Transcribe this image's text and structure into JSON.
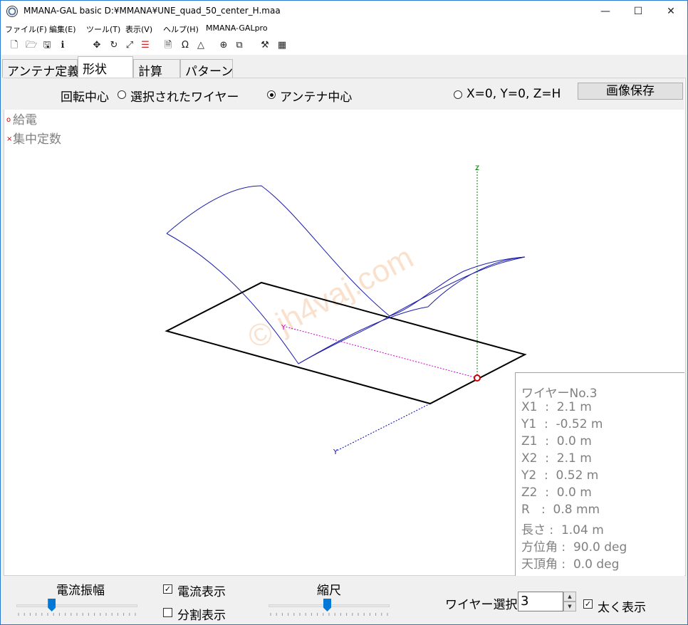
{
  "window": {
    "title": "MMANA-GAL basic  D:¥MMANA¥UNE_quad_50_center_H.maa",
    "min_glyph": "—",
    "max_glyph": "☐",
    "close_glyph": "✕"
  },
  "menu": [
    "ファイル(F)",
    "編集(E)",
    "ツール(T)",
    "表示(V)",
    "ヘルプ(H)",
    "MMANA-GALpro"
  ],
  "toolbar_icons": [
    {
      "name": "new-file-icon",
      "glyph": "🗋"
    },
    {
      "name": "open-folder-icon",
      "glyph": "🗁"
    },
    {
      "name": "save-disk-icon",
      "glyph": "🖫"
    },
    {
      "name": "info-icon",
      "glyph": "ℹ"
    },
    {
      "name": "move-icon",
      "glyph": "✥"
    },
    {
      "name": "rotate-icon",
      "glyph": "↻"
    },
    {
      "name": "resize-icon",
      "glyph": "⤢"
    },
    {
      "name": "wire-list-icon",
      "glyph": "☰"
    },
    {
      "name": "document-icon",
      "glyph": "🗎"
    },
    {
      "name": "omega-icon",
      "glyph": "Ω"
    },
    {
      "name": "triangle-icon",
      "glyph": "△"
    },
    {
      "name": "crosshair-icon",
      "glyph": "⊕"
    },
    {
      "name": "copy-icon",
      "glyph": "⧉"
    },
    {
      "name": "tools-icon",
      "glyph": "⚒"
    },
    {
      "name": "calculator-icon",
      "glyph": "▦"
    }
  ],
  "tabs": [
    "アンテナ定義",
    "形状",
    "計算",
    "パターン"
  ],
  "rotation": {
    "label": "回転中心",
    "opt_selected_wire": "選択されたワイヤー",
    "opt_antenna_center": "アンテナ中心",
    "opt_origin": "X=0, Y=0, Z=H",
    "selected": "アンテナ中心",
    "save_image": "画像保存"
  },
  "legend": {
    "feed_marker": "o",
    "feed": "給電",
    "load_marker": "×",
    "load": "集中定数"
  },
  "axes": {
    "y_label": "Y",
    "x_label": "Y",
    "z_label": "Z"
  },
  "watermark": "© jh4vaj.com",
  "colors": {
    "wire": "#000000",
    "current": "#1c1caa",
    "feed": "#cc0000",
    "axis_z": "#008000",
    "axis_x": "#cc00cc",
    "axis_y": "#0000bb"
  },
  "wire_info": {
    "title": "ワイヤーNo.3",
    "lines": [
      "X1  :  2.1 m",
      "Y1  :  -0.52 m",
      "Z1  :  0.0 m",
      "X2  :  2.1 m",
      "Y2  :  0.52 m",
      "Z2  :  0.0 m",
      "R   :  0.8 mm",
      "長さ :  1.04 m",
      "方位角 :  90.0 deg",
      "天頂角 :  0.0 deg"
    ]
  },
  "bottom": {
    "current_amplitude": "電流振幅",
    "show_current": "電流表示",
    "show_current_checked": true,
    "show_segments": "分割表示",
    "show_segments_checked": false,
    "scale": "縮尺",
    "wire_select_label": "ワイヤー選択",
    "wire_select_value": "3",
    "bold_display": "太く表示",
    "bold_display_checked": true,
    "current_amp_level": 0.3,
    "scale_level": 0.5
  }
}
